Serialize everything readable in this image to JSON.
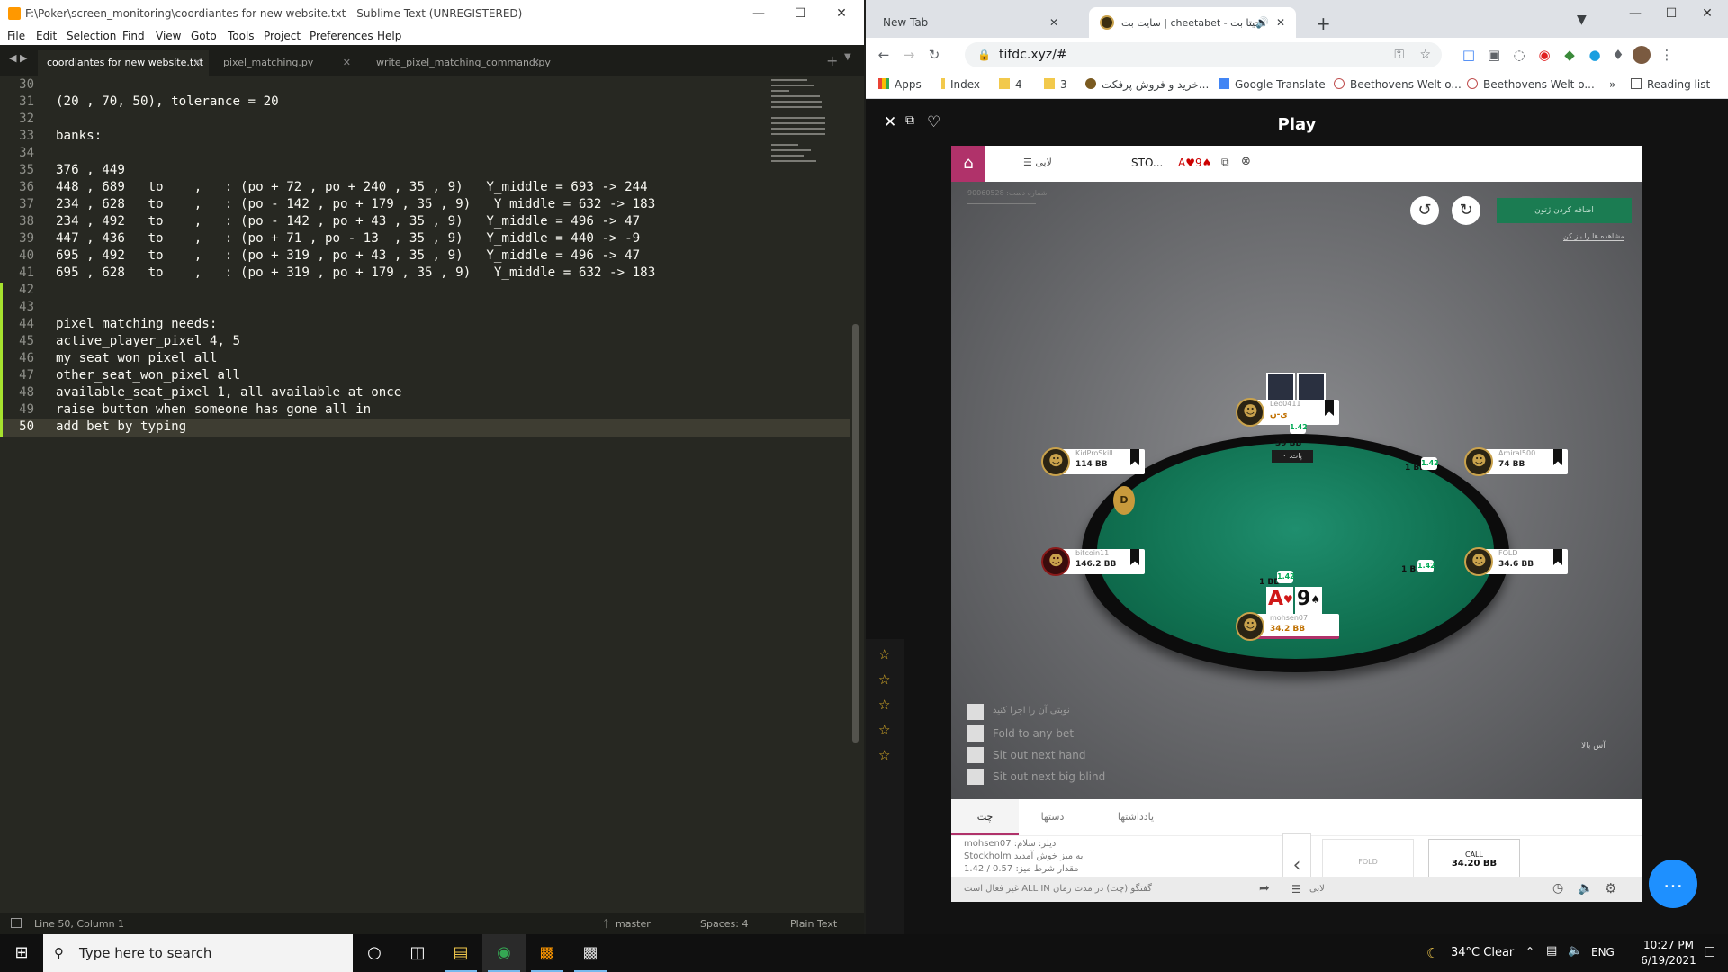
{
  "sublime": {
    "title": "F:\\Poker\\screen_monitoring\\coordiantes for new website.txt - Sublime Text (UNREGISTERED)",
    "menu": [
      "File",
      "Edit",
      "Selection",
      "Find",
      "View",
      "Goto",
      "Tools",
      "Project",
      "Preferences",
      "Help"
    ],
    "tabs": [
      {
        "label": "coordiantes for new website.txt"
      },
      {
        "label": "pixel_matching.py"
      },
      {
        "label": "write_pixel_matching_command.py"
      }
    ],
    "lines": [
      {
        "n": "30",
        "text": ""
      },
      {
        "n": "31",
        "text": "(20 , 70, 50), tolerance = 20"
      },
      {
        "n": "32",
        "text": ""
      },
      {
        "n": "33",
        "text": "banks:"
      },
      {
        "n": "34",
        "text": ""
      },
      {
        "n": "35",
        "text": "376 , 449"
      },
      {
        "n": "36",
        "text": "448 , 689   to    ,   : (po + 72 , po + 240 , 35 , 9)   Y_middle = 693 -> 244"
      },
      {
        "n": "37",
        "text": "234 , 628   to    ,   : (po - 142 , po + 179 , 35 , 9)   Y_middle = 632 -> 183"
      },
      {
        "n": "38",
        "text": "234 , 492   to    ,   : (po - 142 , po + 43 , 35 , 9)   Y_middle = 496 -> 47"
      },
      {
        "n": "39",
        "text": "447 , 436   to    ,   : (po + 71 , po - 13  , 35 , 9)   Y_middle = 440 -> -9"
      },
      {
        "n": "40",
        "text": "695 , 492   to    ,   : (po + 319 , po + 43 , 35 , 9)   Y_middle = 496 -> 47"
      },
      {
        "n": "41",
        "text": "695 , 628   to    ,   : (po + 319 , po + 179 , 35 , 9)   Y_middle = 632 -> 183"
      },
      {
        "n": "42",
        "text": ""
      },
      {
        "n": "43",
        "text": ""
      },
      {
        "n": "44",
        "text": "pixel matching needs:"
      },
      {
        "n": "45",
        "text": "active_player_pixel 4, 5"
      },
      {
        "n": "46",
        "text": "my_seat_won_pixel all"
      },
      {
        "n": "47",
        "text": "other_seat_won_pixel all"
      },
      {
        "n": "48",
        "text": "available_seat_pixel 1, all available at once"
      },
      {
        "n": "49",
        "text": "raise button when someone has gone all in"
      },
      {
        "n": "50",
        "text": "add bet by typing"
      }
    ],
    "status": {
      "position": "Line 50, Column 1",
      "branch": "master",
      "spaces": "Spaces: 4",
      "syntax": "Plain Text"
    }
  },
  "chrome": {
    "tabs": [
      {
        "label": "New Tab"
      },
      {
        "label": "سایت بت | cheetabet - چیتا بت"
      }
    ],
    "url": "tifdc.xyz/#",
    "bookmarks": [
      "Apps",
      "Index",
      "4",
      "3",
      "خرید و فروش پرفکت...",
      "Google Translate",
      "Beethovens Welt o...",
      "Beethovens Welt o..."
    ],
    "reading_list": "Reading list",
    "more": "»"
  },
  "game": {
    "page_title": "Play",
    "lobby_tab": "لابی",
    "table_tab": "STO...",
    "table_cards": "A♥9♠",
    "top_action": "اضافه کردن ژتون",
    "hand_id": "90060528 :شماره دست",
    "notes_link": "مشاهده ها را باز کن",
    "pot": "39 BB",
    "pot_label": "پات: ۰",
    "dealer": "D",
    "seats": [
      {
        "name": "Leo0411",
        "stack": "ی-ن"
      },
      {
        "name": "KidProSkill",
        "stack": "114 BB"
      },
      {
        "name": "Amiral500",
        "stack": "74 BB"
      },
      {
        "name": "bitcoin11",
        "stack": "146.2 BB"
      },
      {
        "name": "FOLD",
        "stack": "34.6 BB"
      },
      {
        "name": "mohsen07",
        "stack": "34.2 BB"
      }
    ],
    "bets": [
      "1 BB",
      "1 BB",
      "1 BB"
    ],
    "chips": [
      "1.42",
      "1.42",
      "1.42",
      "1.42"
    ],
    "hero_cards": {
      "c1": "A",
      "s1": "♥",
      "c2": "9",
      "s2": "♠"
    },
    "options": [
      "نوبتی آن را اجرا کنید",
      "Fold to any bet",
      "Sit out next hand",
      "Sit out next big blind"
    ],
    "side_text": "آس‌ بالا",
    "chat_tabs": [
      "چت",
      "دستها",
      "یادداشتها"
    ],
    "chat_lines": [
      "mohsen07 :دیلر: سلام",
      "Stockholm به میز خوش آمدید",
      "مقدار شرط میز: 0.57 / 1.42"
    ],
    "fold_label": "FOLD",
    "call_label": "CALL",
    "call_amount": "34.20 BB",
    "footer_text": "غیر فعال است ALL IN گفتگو (چت) در مدت زمان",
    "footer_lobby": "لابی"
  },
  "taskbar": {
    "search_placeholder": "Type here to search",
    "weather": "34°C  Clear",
    "lang": "ENG",
    "time": "10:27 PM",
    "date": "6/19/2021"
  }
}
